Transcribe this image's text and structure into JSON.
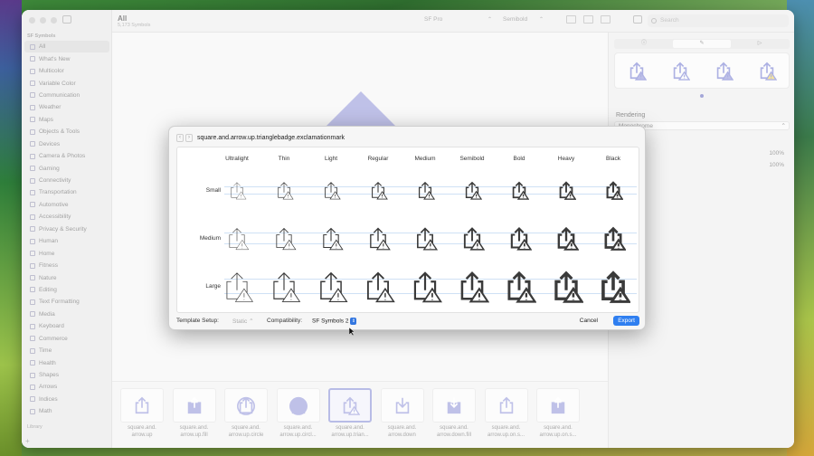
{
  "colors": {
    "accent": "#7e86d1",
    "export_blue": "#2f7ff0",
    "symbol_purple": "#8b8fd6"
  },
  "sidebar": {
    "section": "SF Symbols",
    "items": [
      {
        "label": "All",
        "active": true
      },
      {
        "label": "What's New"
      },
      {
        "label": "Multicolor"
      },
      {
        "label": "Variable Color"
      },
      {
        "label": "Communication"
      },
      {
        "label": "Weather"
      },
      {
        "label": "Maps"
      },
      {
        "label": "Objects & Tools"
      },
      {
        "label": "Devices"
      },
      {
        "label": "Camera & Photos"
      },
      {
        "label": "Gaming"
      },
      {
        "label": "Connectivity"
      },
      {
        "label": "Transportation"
      },
      {
        "label": "Automotive"
      },
      {
        "label": "Accessibility"
      },
      {
        "label": "Privacy & Security"
      },
      {
        "label": "Human"
      },
      {
        "label": "Home"
      },
      {
        "label": "Fitness"
      },
      {
        "label": "Nature"
      },
      {
        "label": "Editing"
      },
      {
        "label": "Text Formatting"
      },
      {
        "label": "Media"
      },
      {
        "label": "Keyboard"
      },
      {
        "label": "Commerce"
      },
      {
        "label": "Time"
      },
      {
        "label": "Health"
      },
      {
        "label": "Shapes"
      },
      {
        "label": "Arrows"
      },
      {
        "label": "Indices"
      },
      {
        "label": "Math"
      }
    ],
    "footer": "Library",
    "add_label": "+"
  },
  "toolbar": {
    "title": "All",
    "subtitle": "5,173 Symbols",
    "font": "SF Pro",
    "weight": "Semibold",
    "search_placeholder": "Search"
  },
  "grid": {
    "tiles": [
      {
        "caption": "square.and.\narrow.up",
        "icon": "share-icon"
      },
      {
        "caption": "square.and.\narrow.up.fill",
        "icon": "share-fill-icon"
      },
      {
        "caption": "square.and.\narrow.up.circle",
        "icon": "share-circle-icon"
      },
      {
        "caption": "square.and.\narrow.up.circl...",
        "icon": "share-circle-fill-icon"
      },
      {
        "caption": "square.and.\narrow.up.trian...",
        "icon": "share-triangle-badge-icon",
        "selected": true
      },
      {
        "caption": "square.and.\narrow.down",
        "icon": "download-icon"
      },
      {
        "caption": "square.and.\narrow.down.fill",
        "icon": "download-fill-icon"
      },
      {
        "caption": "square.and.\narrow.up.on.s...",
        "icon": "share-on-square-icon"
      },
      {
        "caption": "square.and.\narrow.up.on.s...",
        "icon": "share-on-square-fill-icon"
      }
    ]
  },
  "inspector": {
    "tabs": [
      "info-icon",
      "paintbrush-icon",
      "play-icon"
    ],
    "rendering_label": "Rendering",
    "rendering_value": "Monochrome",
    "pct1": "100%",
    "pct2": "100%"
  },
  "modal": {
    "title": "square.and.arrow.up.trianglebadge.exclamationmark",
    "columns": [
      "Ultralight",
      "Thin",
      "Light",
      "Regular",
      "Medium",
      "Semibold",
      "Bold",
      "Heavy",
      "Black"
    ],
    "rows": [
      "Small",
      "Medium",
      "Large"
    ],
    "template_setup_label": "Template Setup:",
    "template_setup_value": "Static",
    "compatibility_label": "Compatibility:",
    "compatibility_value": "SF Symbols 2",
    "cancel_label": "Cancel",
    "export_label": "Export"
  }
}
